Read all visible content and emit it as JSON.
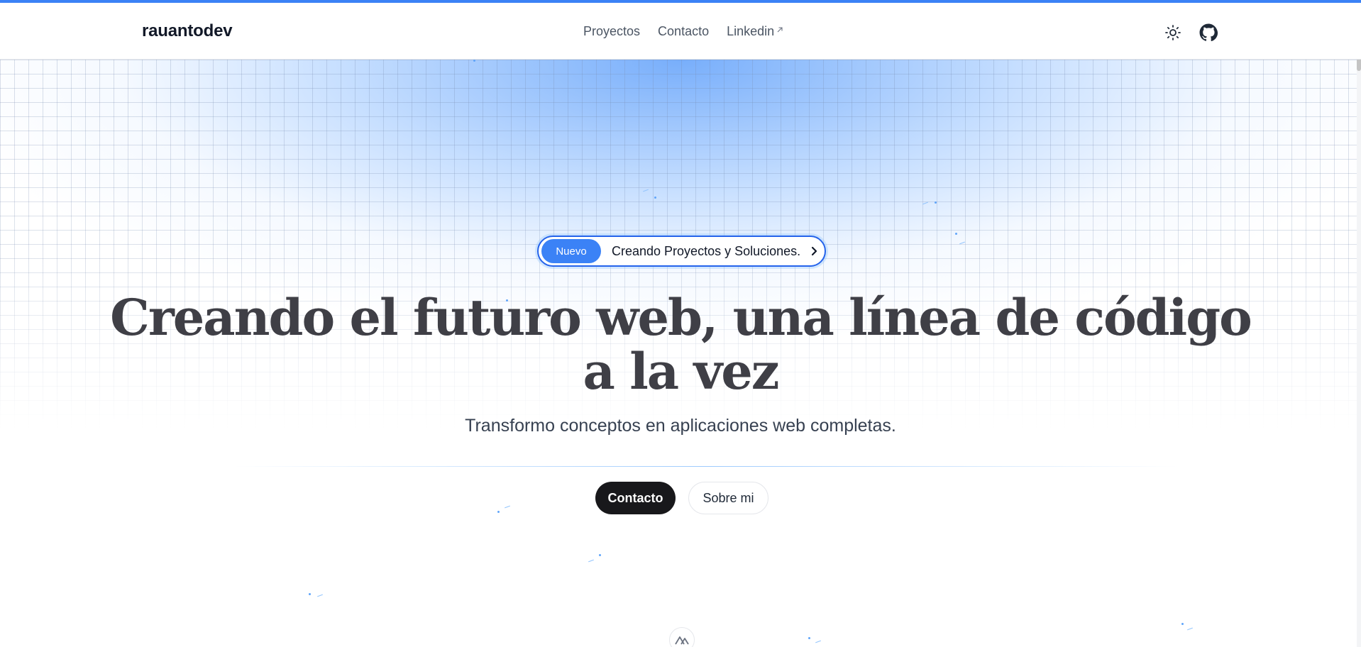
{
  "navbar": {
    "brand": "rauantodev",
    "links": [
      {
        "label": "Proyectos"
      },
      {
        "label": "Contacto"
      },
      {
        "label": "Linkedin",
        "icon": "external-link-icon"
      }
    ],
    "right_icons": [
      "sun-icon",
      "github-icon"
    ]
  },
  "hero": {
    "badge": {
      "tag": "Nuevo",
      "text": "Creando Proyectos y Soluciones.",
      "icon": "chevron-right-icon"
    },
    "headline_line1": "Creando el futuro web, una línea de código",
    "headline_line2": "a la vez",
    "subheadline": "Transformo conceptos en aplicaciones web completas.",
    "cta_primary": "Contacto",
    "cta_secondary": "Sobre mi",
    "bottom_icon": "nuxt-logo-icon"
  },
  "colors": {
    "accent": "#3b82f6",
    "primary_button": "#18181b",
    "headline": "#3f3f46",
    "grid_glow": "#60a5fa"
  }
}
